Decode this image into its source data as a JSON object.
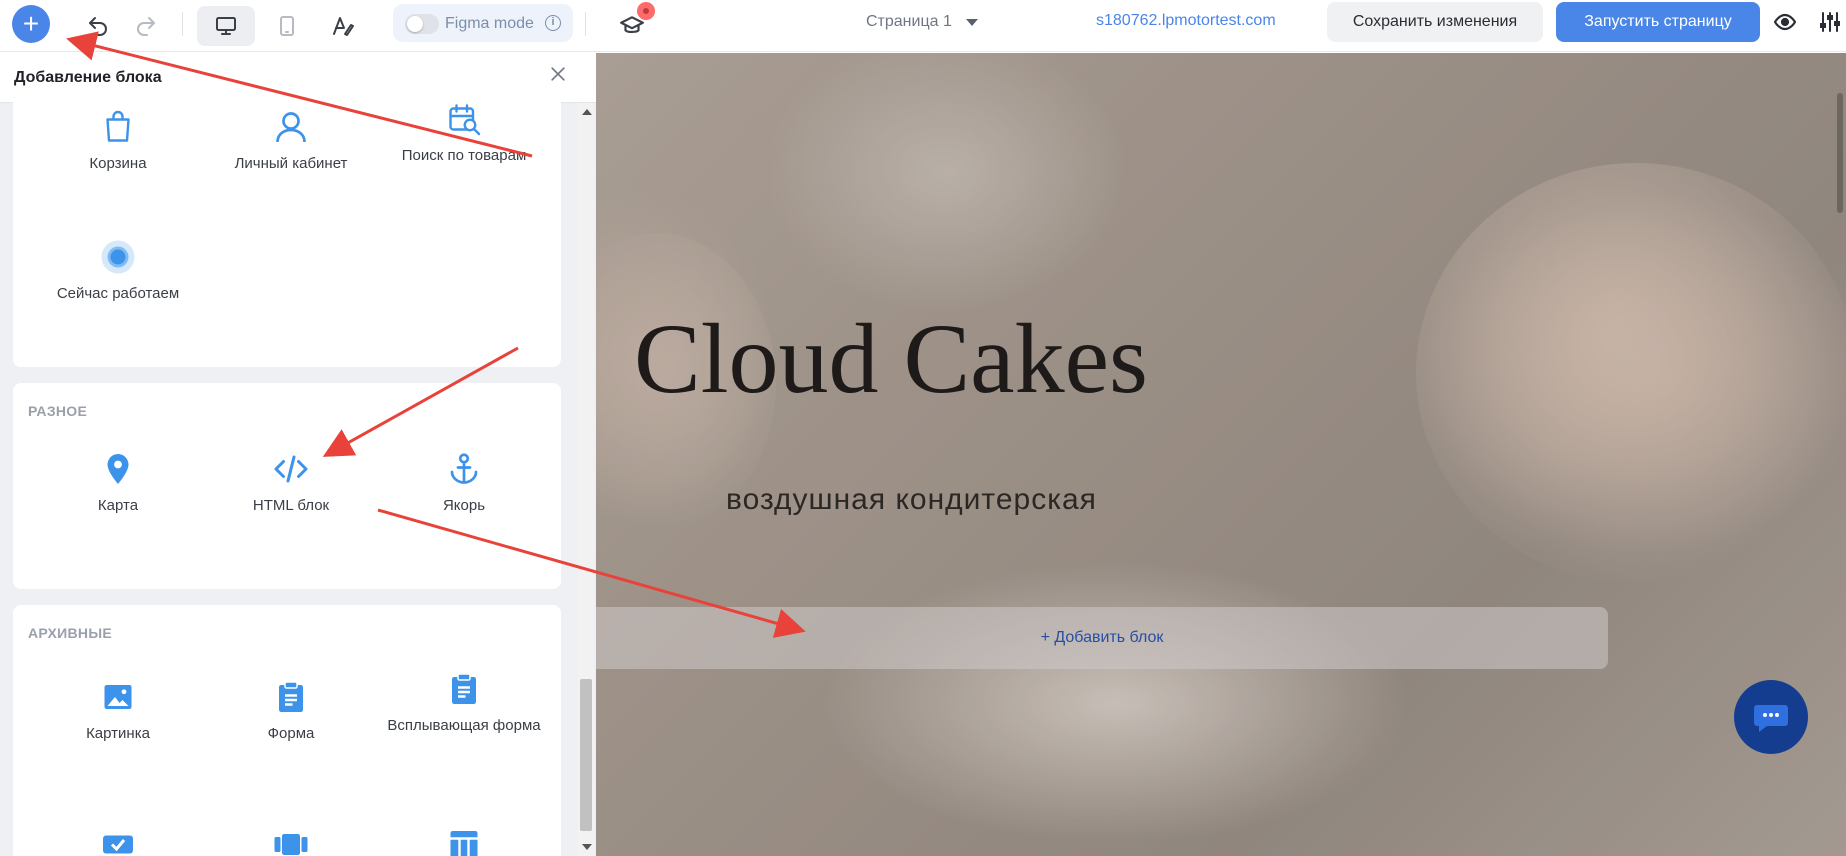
{
  "toolbar": {
    "add_symbol": "+",
    "figma_mode_label": "Figma mode",
    "figma_info_symbol": "i",
    "page_name": "Страница 1",
    "domain": "s180762.lpmotortest.com",
    "save_label": "Сохранить изменения",
    "launch_label": "Запустить страницу",
    "accent_color": "#4a86e8"
  },
  "panel": {
    "title": "Добавление блока",
    "sections": {
      "top_items": [
        {
          "label": "Корзина",
          "icon": "shopping-bag-icon"
        },
        {
          "label": "Личный кабинет",
          "icon": "user-icon"
        },
        {
          "label": "Поиск по товарам",
          "icon": "calendar-search-icon"
        },
        {
          "label": "Сейчас работаем",
          "icon": "status-dot-icon"
        }
      ],
      "misc": {
        "title": "РАЗНОЕ",
        "items": [
          {
            "label": "Карта",
            "icon": "map-pin-icon"
          },
          {
            "label": "HTML блок",
            "icon": "code-icon"
          },
          {
            "label": "Якорь",
            "icon": "anchor-icon"
          }
        ]
      },
      "archive": {
        "title": "АРХИВНЫЕ",
        "items": [
          {
            "label": "Картинка",
            "icon": "image-icon"
          },
          {
            "label": "Форма",
            "icon": "form-icon"
          },
          {
            "label": "Всплывающая форма",
            "icon": "popup-form-icon"
          },
          {
            "label": "",
            "icon": "checkbox-icon"
          },
          {
            "label": "",
            "icon": "carousel-icon"
          },
          {
            "label": "",
            "icon": "table-icon"
          }
        ]
      }
    }
  },
  "canvas": {
    "hero_title": "Cloud Cakes",
    "hero_subtitle": "воздушная кондитерская",
    "add_block_label": "+ Добавить блок"
  },
  "annotation_color": "#e8423a"
}
